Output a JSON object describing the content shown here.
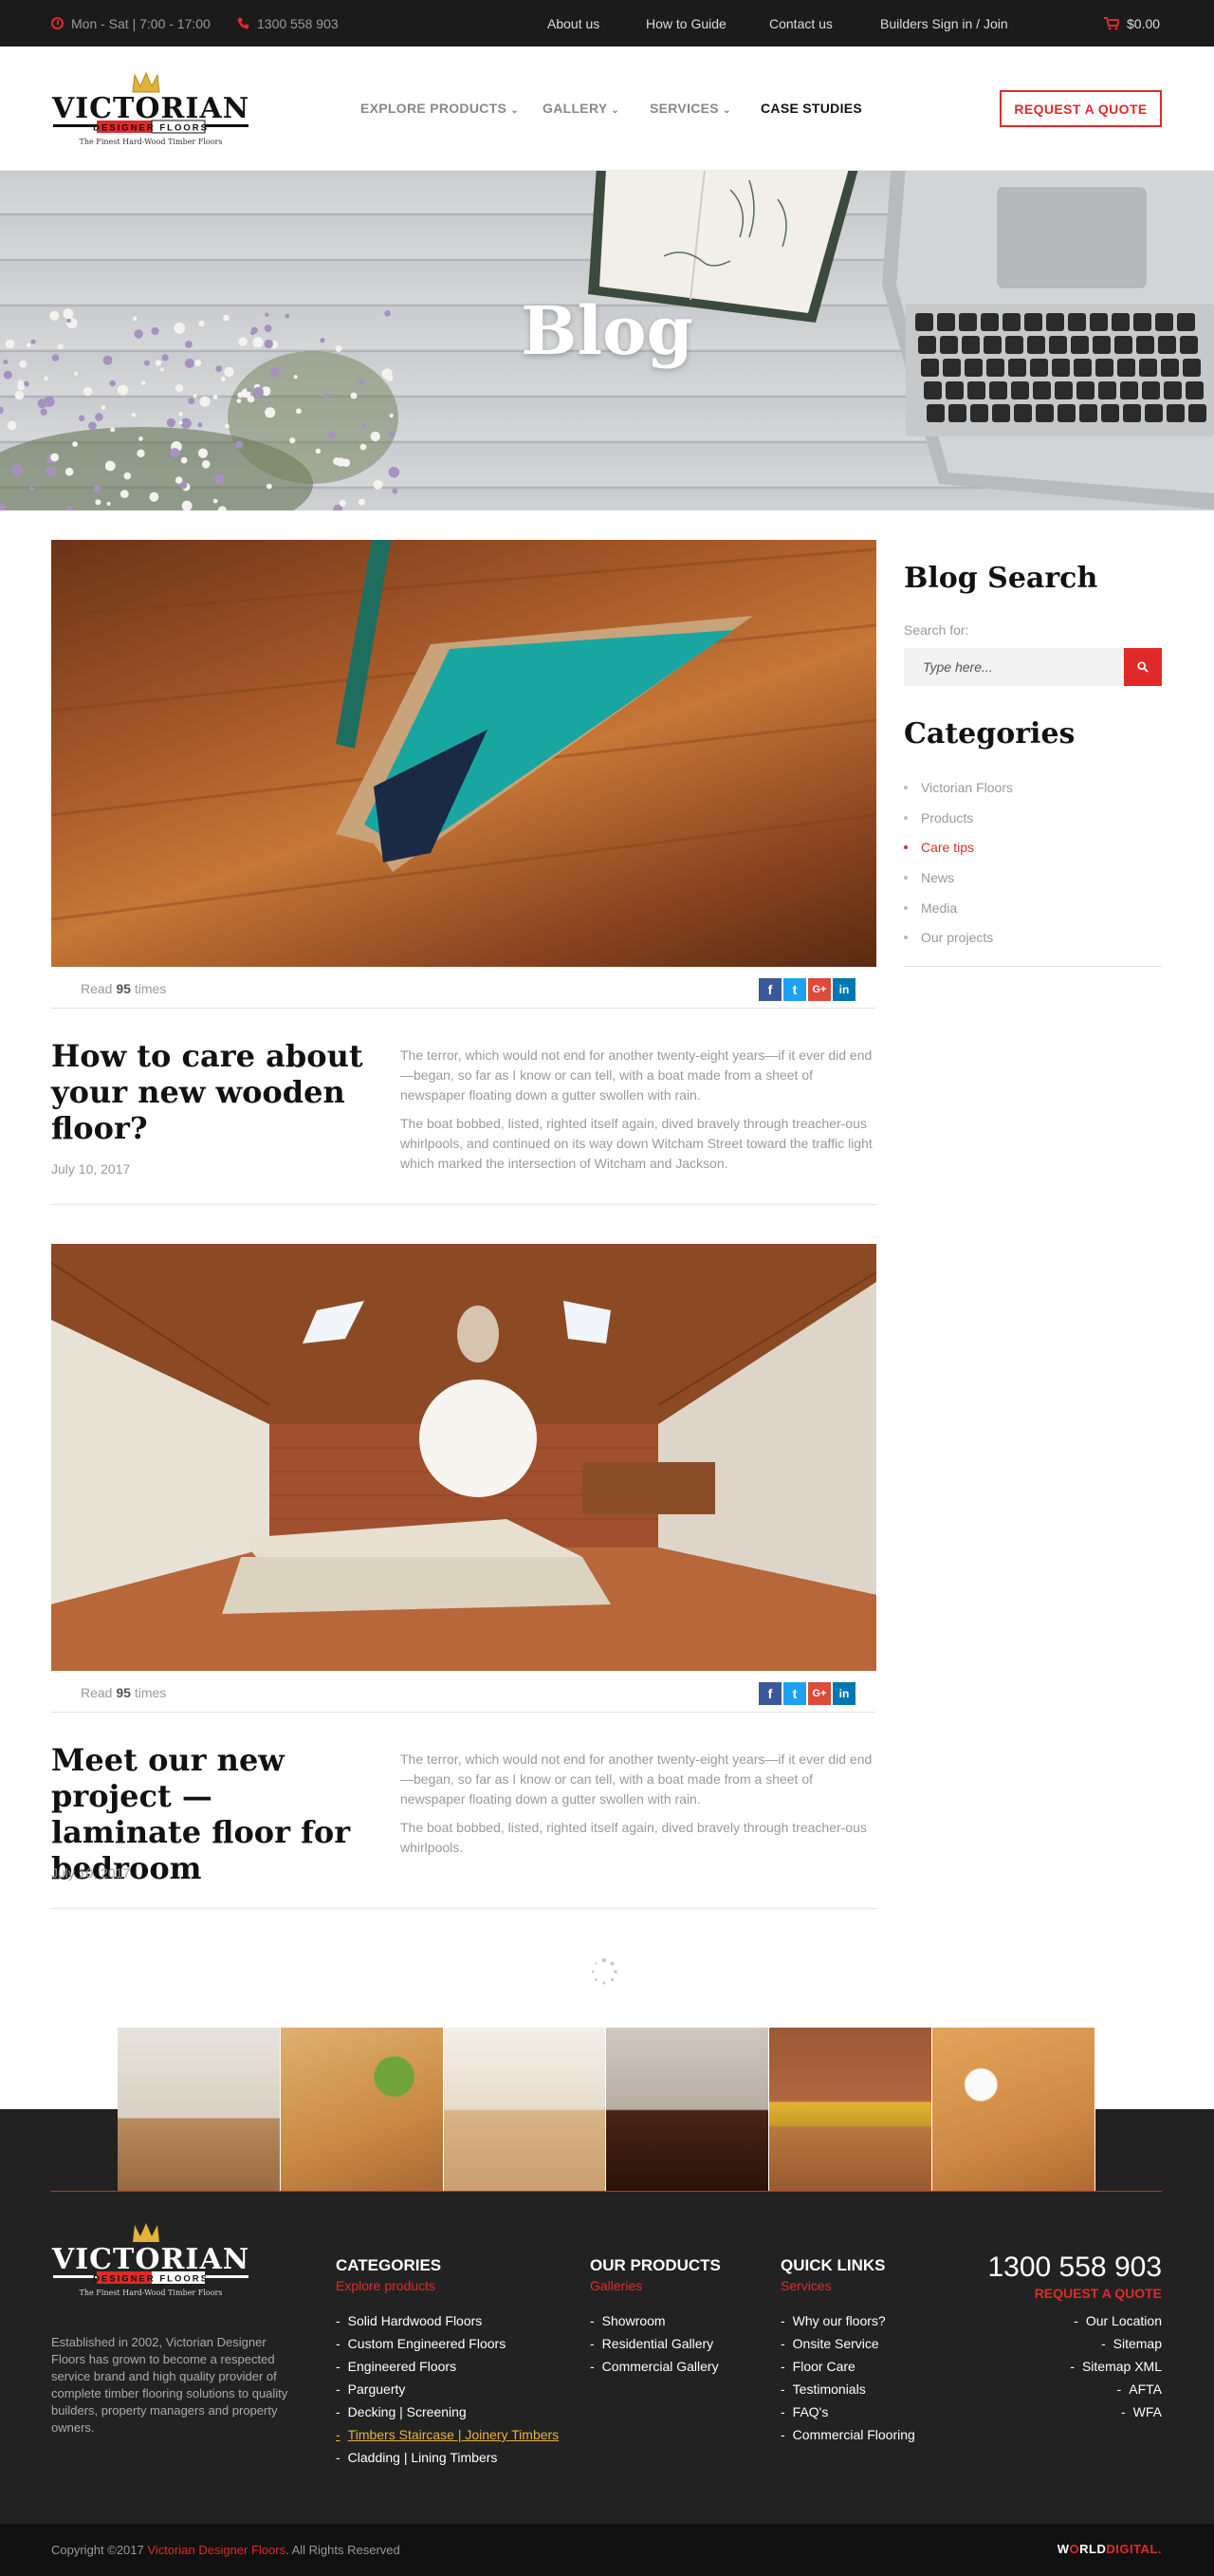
{
  "topbar": {
    "hours": "Mon - Sat | 7:00 - 17:00",
    "phone": "1300 558 903",
    "links": [
      "About us",
      "How to Guide",
      "Contact us",
      "Builders Sign in / Join"
    ],
    "cart_total": "$0.00"
  },
  "logo": {
    "name": "VICTORIAN",
    "sub": "DESIGNER FLOORS",
    "tagline": "The Finest Hard-Wood Timber Floors"
  },
  "nav": {
    "items": [
      "EXPLORE PRODUCTS",
      "GALLERY",
      "SERVICES",
      "CASE STUDIES"
    ],
    "quote_button": "REQUEST A QUOTE"
  },
  "hero": {
    "title": "Blog"
  },
  "posts": [
    {
      "read_prefix": "Read",
      "read_count": "95",
      "read_suffix": "times",
      "title": "How to care about your new wooden floor?",
      "date": "July 10, 2017",
      "paragraphs": [
        "The terror, which would not end for another twenty-eight years—if it ever did end—began, so far as I know or can tell, with a boat made from a sheet of newspaper floating down a gutter swollen with rain.",
        "The boat bobbed, listed, righted itself again, dived bravely through treacher-ous whirlpools, and continued on its way down Witcham Street toward the traffic light which marked the intersection of Witcham and Jackson."
      ]
    },
    {
      "read_prefix": "Read",
      "read_count": "95",
      "read_suffix": "times",
      "title": "Meet our new project — laminate floor for bedroom",
      "date": "July 10, 2017",
      "paragraphs": [
        "The terror, which would not end for another twenty-eight years—if it ever did end—began, so far as I know or can tell, with a boat made from a sheet of newspaper floating down a gutter swollen with rain.",
        "The boat bobbed, listed, righted itself again, dived bravely through treacher-ous whirlpools."
      ]
    }
  ],
  "share": {
    "facebook": "f",
    "twitter": "t",
    "google": "G+",
    "linkedin": "in"
  },
  "sidebar": {
    "search_heading": "Blog Search",
    "search_label": "Search for:",
    "search_placeholder": "Type here...",
    "categories_heading": "Categories",
    "categories": [
      "Victorian Floors",
      "Products",
      "Care tips",
      "News",
      "Media",
      "Our projects"
    ],
    "active_category": "Care tips"
  },
  "footer": {
    "description": "Established in 2002, Victorian Designer Floors has grown to become a respected service brand and high quality provider of complete timber flooring solutions to quality builders, property managers and property owners.",
    "categories": {
      "heading": "CATEGORIES",
      "sub": "Explore products",
      "items": [
        "Solid Hardwood Floors",
        "Custom Engineered Floors",
        "Engineered Floors",
        "Parguerty",
        "Decking | Screening",
        "Timbers Staircase | Joinery Timbers",
        "Cladding | Lining Timbers"
      ]
    },
    "products": {
      "heading": "OUR PRODUCTS",
      "sub": "Galleries",
      "items": [
        "Showroom",
        "Residential Gallery",
        "Commercial Gallery"
      ]
    },
    "quick": {
      "heading": "QUICK LINKS",
      "sub": "Services",
      "items": [
        "Why our floors?",
        "Onsite Service",
        "Floor Care",
        "Testimonials",
        "FAQ's",
        "Commercial Flooring"
      ]
    },
    "contact": {
      "phone": "1300 558 903",
      "quote": "REQUEST A QUOTE",
      "items": [
        "Our Location",
        "Sitemap",
        "Sitemap XML",
        "AFTA",
        "WFA"
      ]
    },
    "copyright_prefix": "Copyright ©2017",
    "copyright_brand": "Victorian Designer Floors",
    "copyright_suffix": ". All Rights Reserved",
    "credit_a": "W",
    "credit_o": "O",
    "credit_b": "RLD",
    "credit_c": "DIGITAL."
  },
  "colors": {
    "accent": "#e02a2a",
    "dark": "#1b1b1b",
    "footer": "#222222"
  }
}
